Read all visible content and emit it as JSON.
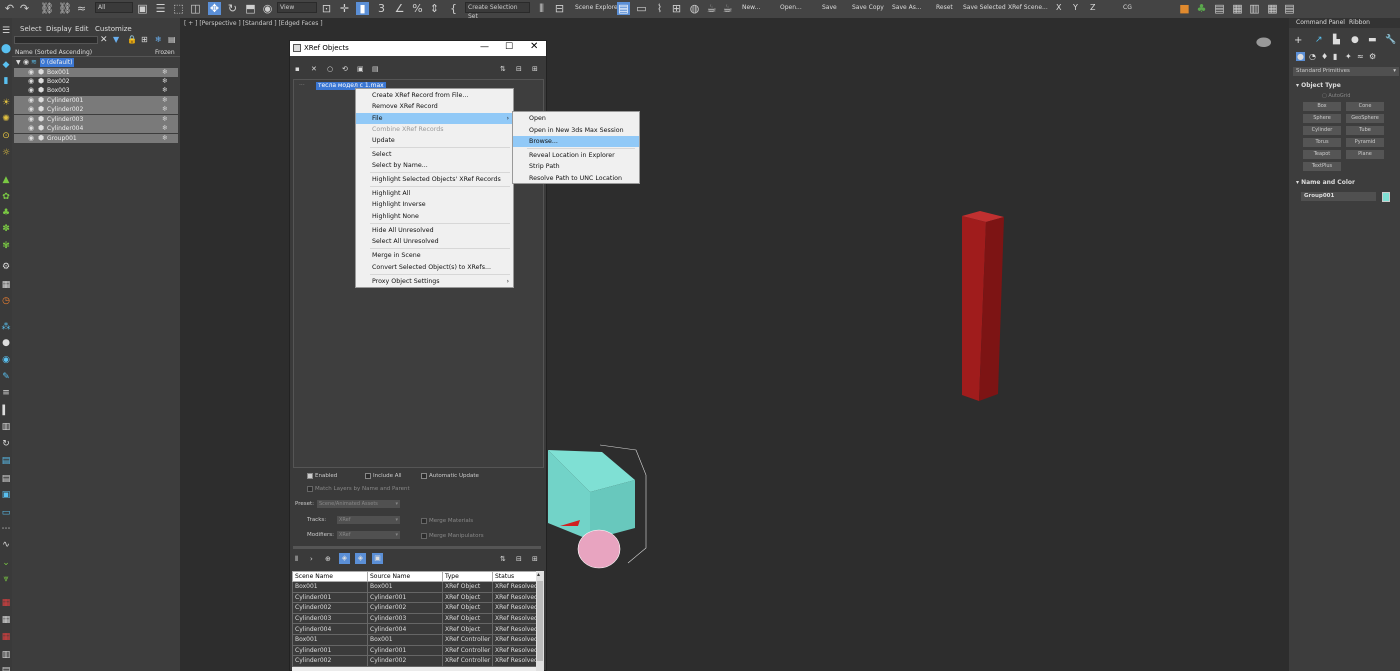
{
  "toolbar": {
    "layer_filter": "All",
    "reference_coord": "View",
    "selection_set": "Create Selection Set",
    "scene_explorer": "Scene Explorer",
    "buttons": [
      "New...",
      "Open...",
      "Save",
      "Save Copy",
      "Save As...",
      "Reset",
      "Save Selected",
      "XRef Scene..."
    ],
    "axes": [
      "X",
      "Y",
      "Z"
    ],
    "workspace": "CG"
  },
  "scene_explorer": {
    "menu": [
      "Select",
      "Display",
      "Edit",
      "Customize"
    ],
    "column_name": "Name (Sorted Ascending)",
    "column_frozen": "Frozen",
    "rows": [
      {
        "name": "0 (default)",
        "selected": false,
        "layer": true
      },
      {
        "name": "Box001",
        "selected": true
      },
      {
        "name": "Box002",
        "selected": false
      },
      {
        "name": "Box003",
        "selected": false
      },
      {
        "name": "Cylinder001",
        "selected": true
      },
      {
        "name": "Cylinder002",
        "selected": true
      },
      {
        "name": "Cylinder003",
        "selected": true
      },
      {
        "name": "Cylinder004",
        "selected": true
      },
      {
        "name": "Group001",
        "selected": true
      }
    ]
  },
  "viewport": {
    "label": "[ + ] [Perspective ] [Standard ] [Edged Faces ]"
  },
  "command_panel": {
    "tabs": [
      "Command Panel",
      "Ribbon"
    ],
    "category": "Standard Primitives",
    "object_type_title": "Object Type",
    "autogrid": "AutoGrid",
    "buttons": [
      "Box",
      "Cone",
      "Sphere",
      "GeoSphere",
      "Cylinder",
      "Tube",
      "Torus",
      "Pyramid",
      "Teapot",
      "Plane",
      "TextPlus"
    ],
    "name_color_title": "Name and Color",
    "object_name": "Group001",
    "object_color": "#7fe0d4"
  },
  "xref": {
    "title": "XRef Objects",
    "tree_item": "тесла модел с 1.max",
    "enabled": "Enabled",
    "include_all": "Include All",
    "automatic_update": "Automatic Update",
    "match_layers": "Match Layers by Name and Parent",
    "preset_label": "Preset:",
    "preset_value": "Scene/Animated Assets",
    "tracks_label": "Tracks:",
    "tracks_value": "XRef",
    "modifiers_label": "Modifiers:",
    "modifiers_value": "XRef",
    "merge_materials": "Merge Materials",
    "merge_manipulators": "Merge Manipulators",
    "columns": [
      "Scene Name",
      "Source Name",
      "Type",
      "Status"
    ],
    "records": [
      [
        "Box001",
        "Box001",
        "XRef Object",
        "XRef Resolved"
      ],
      [
        "Cylinder001",
        "Cylinder001",
        "XRef Object",
        "XRef Resolved"
      ],
      [
        "Cylinder002",
        "Cylinder002",
        "XRef Object",
        "XRef Resolved"
      ],
      [
        "Cylinder003",
        "Cylinder003",
        "XRef Object",
        "XRef Resolved"
      ],
      [
        "Cylinder004",
        "Cylinder004",
        "XRef Object",
        "XRef Resolved"
      ],
      [
        "Box001",
        "Box001",
        "XRef Controller",
        "XRef Resolved"
      ],
      [
        "Cylinder001",
        "Cylinder001",
        "XRef Controller",
        "XRef Resolved"
      ],
      [
        "Cylinder002",
        "Cylinder002",
        "XRef Controller",
        "XRef Resolved"
      ]
    ]
  },
  "context_menu": {
    "items": [
      "Create XRef Record from File...",
      "Remove XRef Record",
      "File",
      "Combine XRef Records",
      "Update",
      "Select",
      "Select by Name...",
      "Highlight Selected Objects' XRef Records",
      "Highlight All",
      "Highlight Inverse",
      "Highlight None",
      "Hide All Unresolved",
      "Select All Unresolved",
      "Merge in Scene",
      "Convert Selected Object(s) to XRefs...",
      "Proxy Object Settings"
    ]
  },
  "file_submenu": {
    "items": [
      "Open",
      "Open in New 3ds Max Session",
      "Browse...",
      "Reveal Location in Explorer",
      "Strip Path",
      "Resolve Path to UNC Location"
    ]
  }
}
